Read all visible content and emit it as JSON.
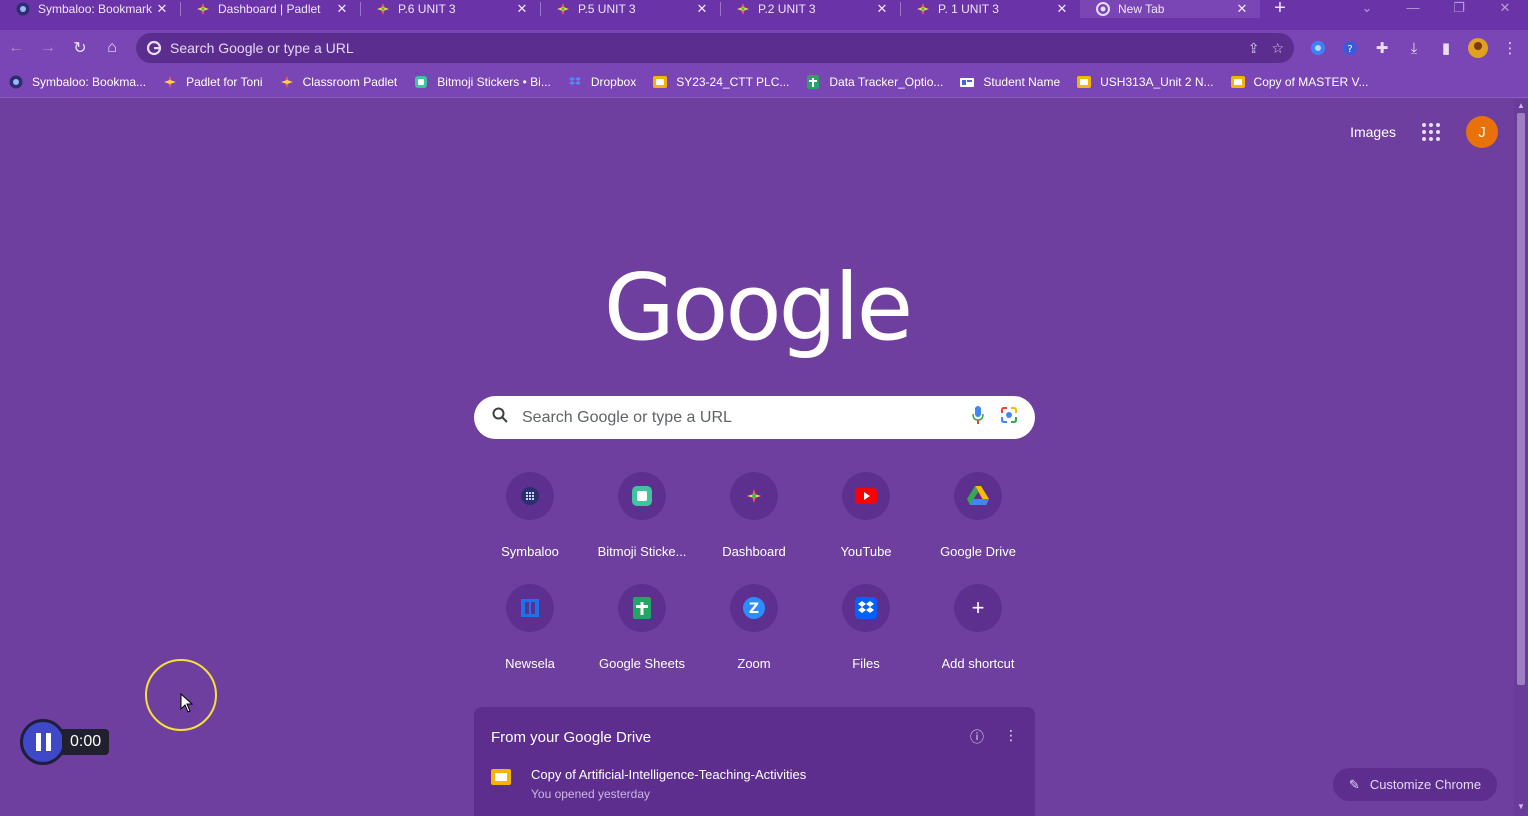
{
  "tabs": [
    {
      "title": "Symbaloo: Bookmark",
      "icon": "symbaloo-icon",
      "active": false
    },
    {
      "title": "Dashboard | Padlet",
      "icon": "padlet-icon",
      "active": false
    },
    {
      "title": "P.6 UNIT 3",
      "icon": "padlet-icon",
      "active": false
    },
    {
      "title": "P.5 UNIT 3",
      "icon": "padlet-icon",
      "active": false
    },
    {
      "title": "P.2 UNIT 3",
      "icon": "padlet-icon",
      "active": false
    },
    {
      "title": "P. 1 UNIT 3",
      "icon": "padlet-icon",
      "active": false
    },
    {
      "title": "New Tab",
      "icon": "chrome-icon",
      "active": true
    }
  ],
  "omnibox": {
    "placeholder": "Search Google or type a URL"
  },
  "bookmarks": [
    {
      "label": "Symbaloo: Bookma...",
      "icon": "symbaloo-icon"
    },
    {
      "label": "Padlet for Toni",
      "icon": "padlet-icon"
    },
    {
      "label": "Classroom Padlet",
      "icon": "padlet-icon"
    },
    {
      "label": "Bitmoji Stickers • Bi...",
      "icon": "bitmoji-icon"
    },
    {
      "label": "Dropbox",
      "icon": "dropbox-icon"
    },
    {
      "label": "SY23-24_CTT PLC...",
      "icon": "slides-icon"
    },
    {
      "label": "Data Tracker_Optio...",
      "icon": "sheets-icon"
    },
    {
      "label": "Student Name",
      "icon": "forms-icon"
    },
    {
      "label": "USH313A_Unit 2 N...",
      "icon": "slides-icon"
    },
    {
      "label": "Copy of MASTER V...",
      "icon": "slides-icon"
    }
  ],
  "header": {
    "images_link": "Images",
    "avatar_letter": "J"
  },
  "logo": "Google",
  "search": {
    "placeholder": "Search Google or type a URL"
  },
  "shortcuts": [
    {
      "label": "Symbaloo",
      "icon": "symbaloo-icon"
    },
    {
      "label": "Bitmoji Sticke...",
      "icon": "bitmoji-icon"
    },
    {
      "label": "Dashboard",
      "icon": "padlet-icon"
    },
    {
      "label": "YouTube",
      "icon": "youtube-icon"
    },
    {
      "label": "Google Drive",
      "icon": "drive-icon"
    },
    {
      "label": "Newsela",
      "icon": "newsela-icon"
    },
    {
      "label": "Google Sheets",
      "icon": "sheets-icon"
    },
    {
      "label": "Zoom",
      "icon": "zoom-icon"
    },
    {
      "label": "Files",
      "icon": "dropbox-icon"
    },
    {
      "label": "Add shortcut",
      "icon": "plus-icon"
    }
  ],
  "drive": {
    "title": "From your Google Drive",
    "file_name": "Copy of Artificial-Intelligence-Teaching-Activities",
    "file_meta": "You opened yesterday"
  },
  "customize": {
    "label": "Customize Chrome"
  },
  "recorder": {
    "time": "0:00"
  },
  "colors": {
    "theme": "#6e3f9e",
    "tab_strip": "#6a33a8",
    "toolbar": "#7a45b4",
    "avatar": "#e8710a",
    "cursor_ring": "#f5e13a"
  }
}
